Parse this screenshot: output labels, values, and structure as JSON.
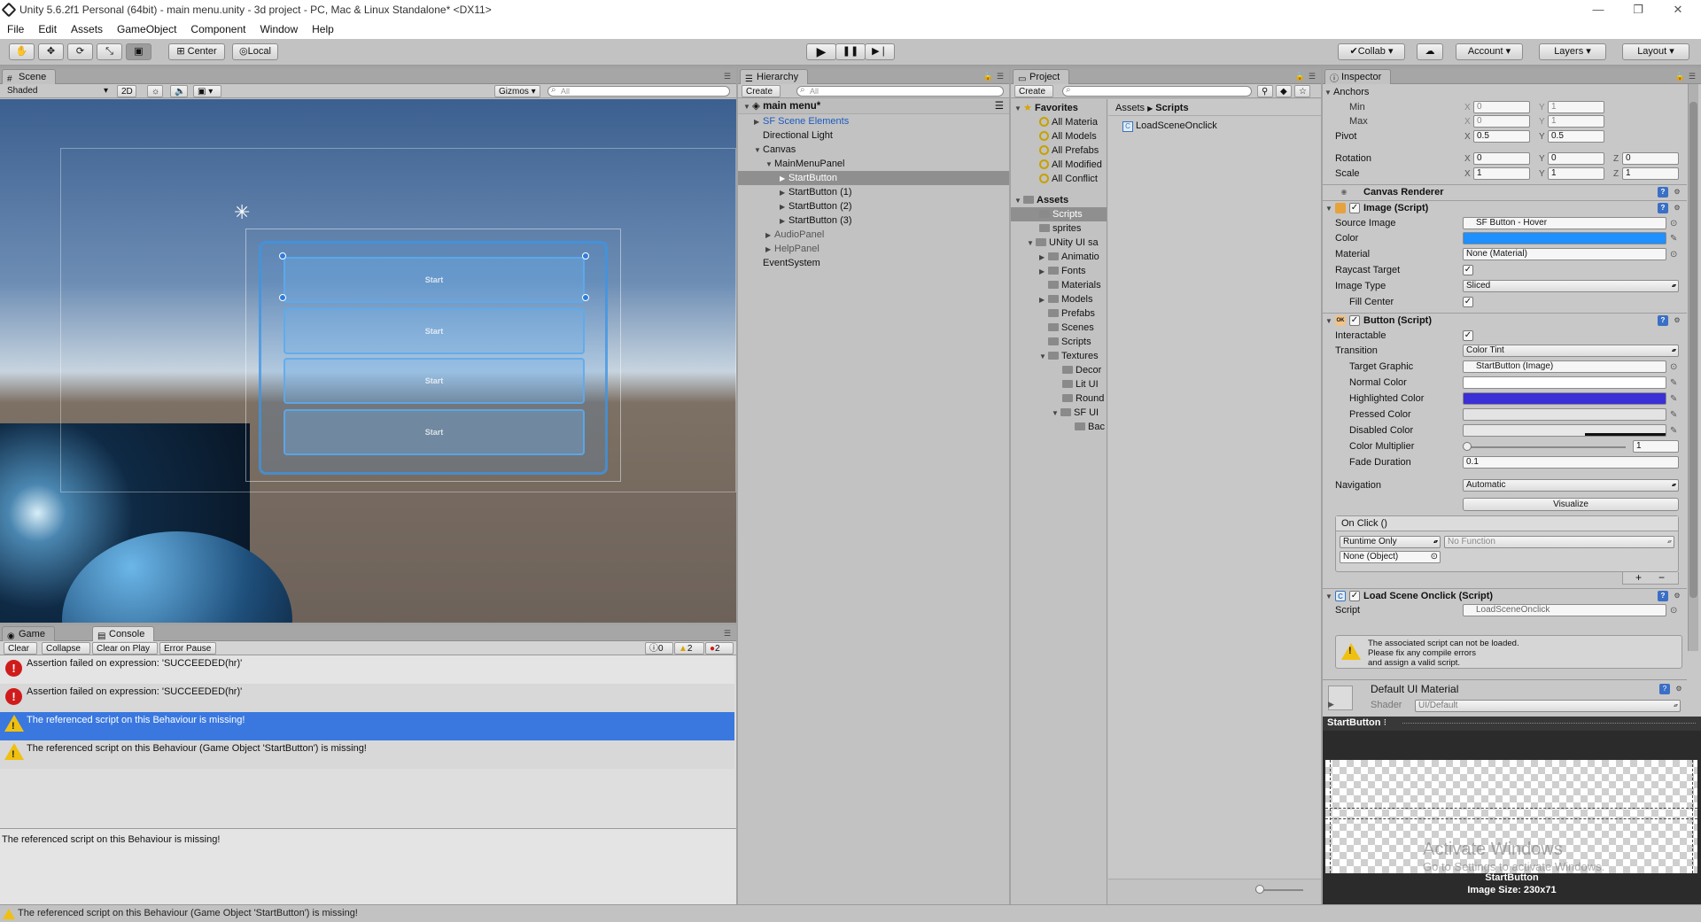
{
  "window": {
    "title": "Unity 5.6.2f1 Personal (64bit) - main menu.unity - 3d project - PC, Mac & Linux Standalone* <DX11>"
  },
  "menu": [
    "File",
    "Edit",
    "Assets",
    "GameObject",
    "Component",
    "Window",
    "Help"
  ],
  "toolbar": {
    "center_label": "Center",
    "local_label": "Local",
    "collab_label": "Collab",
    "account_label": "Account",
    "layers_label": "Layers",
    "layout_label": "Layout"
  },
  "scene": {
    "tab_label": "Scene",
    "shading": "Shaded",
    "mode_2d": "2D",
    "gizmos": "Gizmos",
    "search_placeholder": "All",
    "buttons": [
      "Start",
      "Start",
      "Start",
      "Start"
    ]
  },
  "hierarchy": {
    "tab_label": "Hierarchy",
    "create_label": "Create",
    "search_placeholder": "All",
    "scene_name": "main menu*",
    "items": [
      {
        "label": "SF Scene Elements"
      },
      {
        "label": "Directional Light"
      },
      {
        "label": "Canvas"
      },
      {
        "label": "MainMenuPanel"
      },
      {
        "label": "StartButton"
      },
      {
        "label": "StartButton (1)"
      },
      {
        "label": "StartButton (2)"
      },
      {
        "label": "StartButton (3)"
      },
      {
        "label": "AudioPanel"
      },
      {
        "label": "HelpPanel"
      },
      {
        "label": "EventSystem"
      }
    ]
  },
  "project": {
    "tab_label": "Project",
    "create_label": "Create",
    "favorites_label": "Favorites",
    "favorites": [
      "All Materia",
      "All Models",
      "All Prefabs",
      "All Modified",
      "All Conflict"
    ],
    "assets_label": "Assets",
    "assets": [
      {
        "label": "Scripts"
      },
      {
        "label": "sprites"
      },
      {
        "label": "UNity UI sa"
      },
      {
        "label": "Animatio"
      },
      {
        "label": "Fonts"
      },
      {
        "label": "Materials"
      },
      {
        "label": "Models"
      },
      {
        "label": "Prefabs"
      },
      {
        "label": "Scenes"
      },
      {
        "label": "Scripts"
      },
      {
        "label": "Textures"
      },
      {
        "label": "Decor"
      },
      {
        "label": "Lit UI"
      },
      {
        "label": "Round"
      },
      {
        "label": "SF UI"
      },
      {
        "label": "Bac"
      }
    ],
    "breadcrumb": [
      "Assets",
      "Scripts"
    ],
    "files": [
      "LoadSceneOnclick"
    ]
  },
  "inspector": {
    "tab_label": "Inspector",
    "anchors_label": "Anchors",
    "min_label": "Min",
    "min_x": "0",
    "min_y": "1",
    "max_label": "Max",
    "max_x": "0",
    "max_y": "1",
    "pivot_label": "Pivot",
    "pivot_x": "0.5",
    "pivot_y": "0.5",
    "rotation_label": "Rotation",
    "rotation_x": "0",
    "rotation_y": "0",
    "rotation_z": "0",
    "scale_label": "Scale",
    "scale_x": "1",
    "scale_y": "1",
    "scale_z": "1",
    "canvas_renderer": "Canvas Renderer",
    "image_script": "Image (Script)",
    "source_image_label": "Source Image",
    "source_image": "SF Button - Hover",
    "color_label": "Color",
    "material_label": "Material",
    "material": "None (Material)",
    "raycast_label": "Raycast Target",
    "image_type_label": "Image Type",
    "image_type": "Sliced",
    "fill_center_label": "Fill Center",
    "button_script": "Button (Script)",
    "interactable_label": "Interactable",
    "transition_label": "Transition",
    "transition": "Color Tint",
    "target_graphic_label": "Target Graphic",
    "target_graphic": "StartButton (Image)",
    "normal_color_label": "Normal Color",
    "highlighted_color_label": "Highlighted Color",
    "pressed_color_label": "Pressed Color",
    "disabled_color_label": "Disabled Color",
    "color_multiplier_label": "Color Multiplier",
    "color_multiplier": "1",
    "fade_duration_label": "Fade Duration",
    "fade_duration": "0.1",
    "navigation_label": "Navigation",
    "navigation": "Automatic",
    "visualize_label": "Visualize",
    "onclick_label": "On Click ()",
    "runtime_label": "Runtime Only",
    "no_function_label": "No Function",
    "none_object_label": "None (Object)",
    "plus_label": "+",
    "minus_label": "−",
    "load_scene_script": "Load Scene Onclick (Script)",
    "script_label": "Script",
    "script_value": "LoadSceneOnclick",
    "script_warning_1": "The associated script can not be loaded.",
    "script_warning_2": "Please fix any compile errors",
    "script_warning_3": "and assign a valid script.",
    "default_material": "Default UI Material",
    "shader_label": "Shader",
    "shader_value": "UI/Default",
    "preview_title": "StartButton",
    "preview_name": "StartButton",
    "preview_size": "Image Size: 230x71",
    "watermark_1": "Activate Windows",
    "watermark_2": "Go to Settings to activate Windows.",
    "colors": {
      "color": "#1e90ff",
      "normal": "#ffffff",
      "highlighted": "#3b2fd6",
      "pressed": "#e3e3e3",
      "disabled": "#e8e8e8"
    }
  },
  "console": {
    "game_tab": "Game",
    "console_tab": "Console",
    "buttons": [
      "Clear",
      "Collapse",
      "Clear on Play",
      "Error Pause"
    ],
    "info_count": "0",
    "warn_count": "2",
    "error_count": "2",
    "rows": [
      {
        "type": "error",
        "text": "Assertion failed on expression: 'SUCCEEDED(hr)'"
      },
      {
        "type": "error",
        "text": "Assertion failed on expression: 'SUCCEEDED(hr)'"
      },
      {
        "type": "warning",
        "text": "The referenced script on this Behaviour is missing!"
      },
      {
        "type": "warning",
        "text": "The referenced script on this Behaviour (Game Object 'StartButton') is missing!"
      }
    ],
    "detail": "The referenced script on this Behaviour is missing!"
  },
  "statusbar": {
    "text": "The referenced script on this Behaviour (Game Object 'StartButton') is missing!"
  }
}
